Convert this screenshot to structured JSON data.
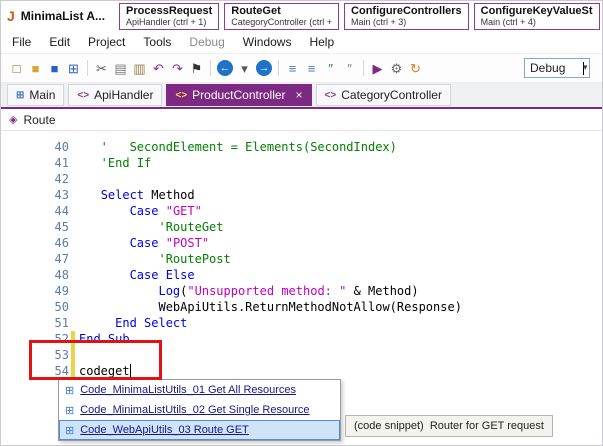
{
  "titlebar": {
    "app_initial": "J",
    "title": "MinimaList A..."
  },
  "quick_access": [
    {
      "name": "ProcessRequest",
      "target": "ApiHandler (ctrl + 1)"
    },
    {
      "name": "RouteGet",
      "target": "CategoryController (ctrl +"
    },
    {
      "name": "ConfigureControllers",
      "target": "Main (ctrl + 3)"
    },
    {
      "name": "ConfigureKeyValueSt",
      "target": "Main (ctrl + 4)"
    }
  ],
  "menu": {
    "items": [
      "File",
      "Edit",
      "Project",
      "Tools",
      "Debug",
      "Windows",
      "Help"
    ]
  },
  "toolbar": {
    "icons": [
      {
        "name": "new-file-icon",
        "glyph": "□",
        "color": "#8a6d2f"
      },
      {
        "name": "open-project-icon",
        "glyph": "■",
        "color": "#d9a43b"
      },
      {
        "name": "save-icon",
        "glyph": "■",
        "color": "#2b5fc7"
      },
      {
        "name": "save-all-icon",
        "glyph": "⊞",
        "color": "#2b5fc7"
      },
      {
        "sep": true
      },
      {
        "name": "cut-icon",
        "glyph": "✂",
        "color": "#555555"
      },
      {
        "name": "copy-icon",
        "glyph": "▤",
        "color": "#777777"
      },
      {
        "name": "paste-icon",
        "glyph": "▥",
        "color": "#9a7b4f"
      },
      {
        "name": "undo-icon",
        "glyph": "↶",
        "color": "#8a2d8a"
      },
      {
        "name": "redo-icon",
        "glyph": "↷",
        "color": "#8a2d8a"
      },
      {
        "name": "bookmark-icon",
        "glyph": "⚑",
        "color": "#333333"
      },
      {
        "sep": true
      },
      {
        "name": "navigate-back-icon",
        "glyph": "←",
        "color": "#ffffff",
        "circle": "#1e72c8"
      },
      {
        "name": "back-history-caret-icon",
        "glyph": "▾",
        "color": "#555555"
      },
      {
        "name": "navigate-forward-icon",
        "glyph": "→",
        "color": "#ffffff",
        "circle": "#1e72c8"
      },
      {
        "sep": true
      },
      {
        "name": "outdent-icon",
        "glyph": "≡",
        "color": "#4a7ab5"
      },
      {
        "name": "indent-icon",
        "glyph": "≡",
        "color": "#4a7ab5"
      },
      {
        "name": "comment-icon",
        "glyph": "″",
        "color": "#2e7d32"
      },
      {
        "name": "uncomment-icon",
        "glyph": "″",
        "color": "#888888"
      },
      {
        "sep": true
      },
      {
        "name": "run-icon",
        "glyph": "▶",
        "color": "#7b2982"
      },
      {
        "name": "generate-members-icon",
        "glyph": "⚙",
        "color": "#666666"
      },
      {
        "name": "clean-project-icon",
        "glyph": "↻",
        "color": "#e07a1f"
      }
    ],
    "mode": {
      "label": "Debug",
      "caret": "▾"
    }
  },
  "tabs": [
    {
      "label": "Main",
      "icon": "form",
      "icon_glyph": "⊞",
      "active": false
    },
    {
      "label": "ApiHandler",
      "icon": "code",
      "icon_glyph": "<>",
      "active": false
    },
    {
      "label": "ProductController",
      "icon": "code",
      "icon_glyph": "<>",
      "active": true,
      "close": "×"
    },
    {
      "label": "CategoryController",
      "icon": "code",
      "icon_glyph": "<>",
      "active": false
    }
  ],
  "breadcrumb": {
    "icon_glyph": "◈",
    "label": "Route"
  },
  "editor": {
    "lines": [
      {
        "no": 40,
        "segs": [
          [
            "com",
            "   '   SecondElement = Elements(SecondIndex)"
          ]
        ]
      },
      {
        "no": 41,
        "segs": [
          [
            "com",
            "   'End If"
          ]
        ]
      },
      {
        "no": 42,
        "segs": []
      },
      {
        "no": 43,
        "segs": [
          [
            "plain",
            "   "
          ],
          [
            "kw",
            "Select"
          ],
          [
            "plain",
            " Method"
          ]
        ]
      },
      {
        "no": 44,
        "segs": [
          [
            "plain",
            "       "
          ],
          [
            "kw",
            "Case"
          ],
          [
            "plain",
            " "
          ],
          [
            "str",
            "\"GET\""
          ]
        ]
      },
      {
        "no": 45,
        "segs": [
          [
            "com",
            "           'RouteGet"
          ]
        ]
      },
      {
        "no": 46,
        "segs": [
          [
            "plain",
            "       "
          ],
          [
            "kw",
            "Case"
          ],
          [
            "plain",
            " "
          ],
          [
            "str",
            "\"POST\""
          ]
        ]
      },
      {
        "no": 47,
        "segs": [
          [
            "com",
            "           'RoutePost"
          ]
        ]
      },
      {
        "no": 48,
        "segs": [
          [
            "plain",
            "       "
          ],
          [
            "kw",
            "Case"
          ],
          [
            "plain",
            " "
          ],
          [
            "kw",
            "Else"
          ]
        ]
      },
      {
        "no": 49,
        "segs": [
          [
            "plain",
            "           "
          ],
          [
            "kw",
            "Log"
          ],
          [
            "plain",
            "("
          ],
          [
            "str",
            "\"Unsupported method: \""
          ],
          [
            "plain",
            " & Method)"
          ]
        ]
      },
      {
        "no": 50,
        "segs": [
          [
            "plain",
            "           "
          ],
          [
            "plain",
            "WebApiUtils.ReturnMethodNotAllow(Response)"
          ]
        ]
      },
      {
        "no": 51,
        "segs": [
          [
            "plain",
            "     "
          ],
          [
            "kw",
            "End Select"
          ]
        ]
      },
      {
        "no": 52,
        "segs": [
          [
            "kw",
            "End Sub"
          ]
        ]
      },
      {
        "no": 53,
        "segs": []
      },
      {
        "no": 54,
        "segs": [
          [
            "plain",
            "codeget"
          ]
        ],
        "caret": true
      }
    ]
  },
  "autocomplete": {
    "icon_glyph": "⊞",
    "items": [
      {
        "label": "Code_MinimaListUtils_01 Get All Resources",
        "selected": false
      },
      {
        "label": "Code_MinimaListUtils_02 Get Single Resource",
        "selected": false
      },
      {
        "label": "Code_WebApiUtils_03 Route GET",
        "selected": true
      }
    ]
  },
  "tooltip": {
    "text": "(code snippet)  Router for GET request"
  },
  "colors": {
    "accent": "#7b2982",
    "keyword": "#0000e6",
    "comment": "#008000",
    "string": "#c000c0",
    "line_number": "#5b7da8",
    "modified_bar": "#e9d44a",
    "annotation": "#e01212",
    "selection": "#cfe4f8"
  }
}
